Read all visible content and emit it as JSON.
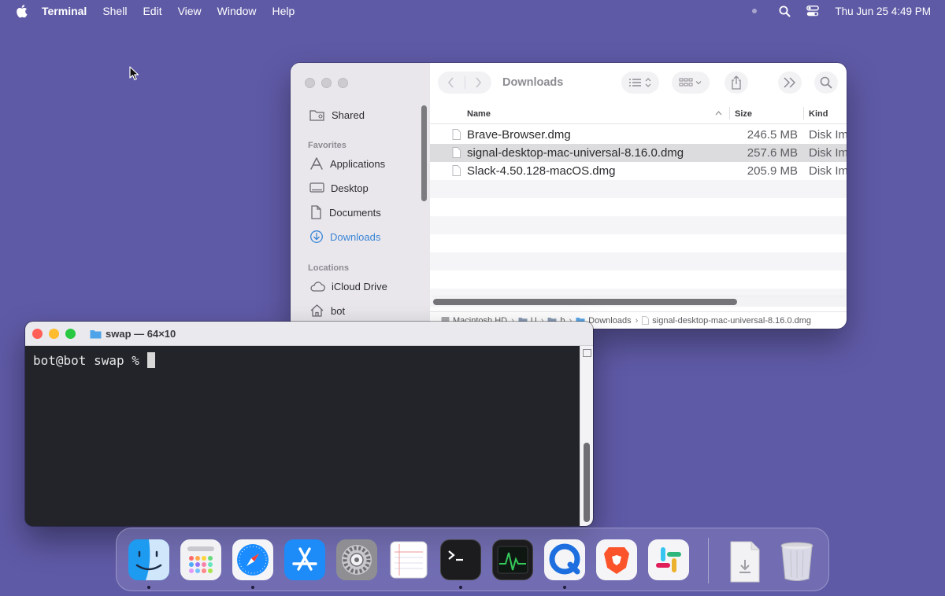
{
  "menubar": {
    "app_name": "Terminal",
    "items": [
      "Shell",
      "Edit",
      "View",
      "Window",
      "Help"
    ],
    "clock": "Thu Jun 25  4:49 PM"
  },
  "finder": {
    "title": "Downloads",
    "sidebar": {
      "shared": "Shared",
      "favorites_header": "Favorites",
      "favorites": [
        "Applications",
        "Desktop",
        "Documents",
        "Downloads"
      ],
      "locations_header": "Locations",
      "locations": [
        "iCloud Drive",
        "bot"
      ]
    },
    "columns": {
      "name": "Name",
      "size": "Size",
      "kind": "Kind"
    },
    "files": [
      {
        "name": "Brave-Browser.dmg",
        "size": "246.5 MB",
        "kind": "Disk Im"
      },
      {
        "name": "signal-desktop-mac-universal-8.16.0.dmg",
        "size": "257.6 MB",
        "kind": "Disk Im"
      },
      {
        "name": "Slack-4.50.128-macOS.dmg",
        "size": "205.9 MB",
        "kind": "Disk Im"
      }
    ],
    "pathbar": [
      "Macintosh HD",
      "U",
      "b",
      "Downloads",
      "signal-desktop-mac-universal-8.16.0.dmg"
    ]
  },
  "terminal": {
    "title": "swap — 64×10",
    "prompt": "bot@bot swap %"
  },
  "dock": {
    "apps": [
      "finder-icon",
      "launchpad-icon",
      "safari-icon",
      "app-store-icon",
      "system-settings-icon",
      "textedit-icon",
      "terminal-icon",
      "activity-monitor-icon",
      "quicktime-icon",
      "brave-icon",
      "slack-icon",
      "downloads-stack-icon",
      "trash-icon"
    ]
  }
}
